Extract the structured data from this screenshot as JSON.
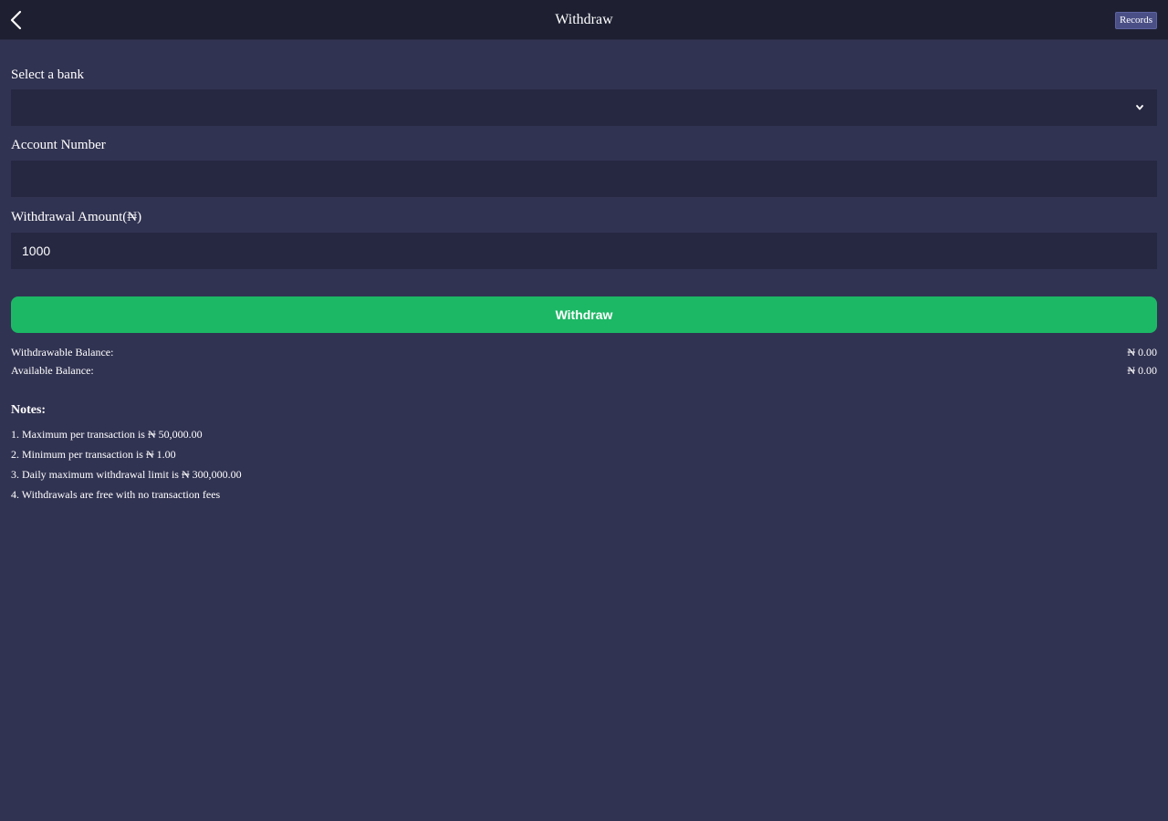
{
  "header": {
    "title": "Withdraw",
    "records_label": "Records",
    "back_icon": "chevron-left-icon"
  },
  "form": {
    "bank_label": "Select a bank",
    "bank_value": "",
    "bank_icon": "chevron-down-icon",
    "account_label": "Account Number",
    "account_value": "",
    "amount_label": "Withdrawal Amount(₦)",
    "amount_value": "1000",
    "submit_label": "Withdraw"
  },
  "balances": {
    "withdrawable_label": "Withdrawable Balance:",
    "withdrawable_value": "₦ 0.00",
    "available_label": "Available Balance:",
    "available_value": "₦ 0.00"
  },
  "notes": {
    "title": "Notes:",
    "items": [
      "1. Maximum per transaction is ₦ 50,000.00",
      "2. Minimum per transaction is ₦ 1.00",
      "3. Daily maximum withdrawal limit is ₦ 300,000.00",
      "4. Withdrawals are free with no transaction fees"
    ]
  },
  "colors": {
    "background": "#313352",
    "header": "#1e2032",
    "input": "#262842",
    "primary_button": "#1cb865",
    "records_button": "#4a4f86"
  }
}
